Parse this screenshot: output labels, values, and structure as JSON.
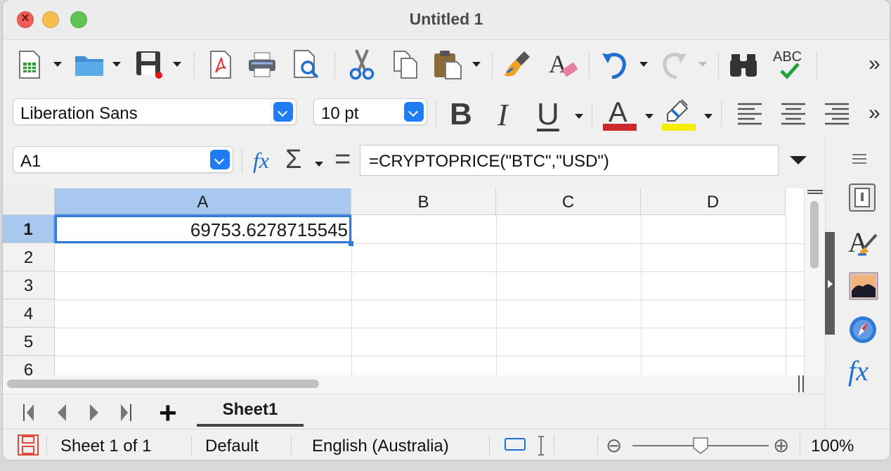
{
  "window": {
    "title": "Untitled 1"
  },
  "toolbar1": {
    "icons": [
      "new-spreadsheet-icon",
      "open-folder-icon",
      "save-icon",
      "export-pdf-icon",
      "print-icon",
      "print-preview-icon",
      "cut-icon",
      "copy-icon",
      "paste-icon",
      "clone-formatting-icon",
      "clear-formatting-icon",
      "undo-icon",
      "redo-icon",
      "find-replace-icon",
      "spellcheck-icon"
    ],
    "spellcheck_label": "ABC",
    "more": "»"
  },
  "toolbar2": {
    "font_name": "Liberation Sans",
    "font_size": "10 pt",
    "bold": "B",
    "italic": "I",
    "underline": "U",
    "font_color_letter": "A",
    "font_color": "#cc2a2a",
    "highlight_color": "#f5ee00",
    "more": "»"
  },
  "formula_bar": {
    "name_box": "A1",
    "fx": "fx",
    "sigma": "Σ",
    "equals": "=",
    "content": "=CRYPTOPRICE(\"BTC\",\"USD\")"
  },
  "grid": {
    "columns": [
      "A",
      "B",
      "C",
      "D"
    ],
    "rows": [
      "1",
      "2",
      "3",
      "4",
      "5",
      "6"
    ],
    "selected_cell": "A1",
    "cells": {
      "A1": "69753.6278715545"
    }
  },
  "sheet_tabs": {
    "tabs": [
      "Sheet1"
    ],
    "add_label": "+"
  },
  "status_bar": {
    "sheet_info": "Sheet 1 of 1",
    "page_style": "Default",
    "language": "English (Australia)",
    "zoom_minus": "⊖",
    "zoom_plus": "⊕",
    "zoom_level": "100%",
    "zoom_fraction": 0.5
  },
  "sidebar": {
    "icons": [
      "sidebar-menu-icon",
      "properties-icon",
      "styles-icon",
      "gallery-icon",
      "navigator-icon",
      "functions-icon"
    ],
    "functions_label": "fx"
  }
}
